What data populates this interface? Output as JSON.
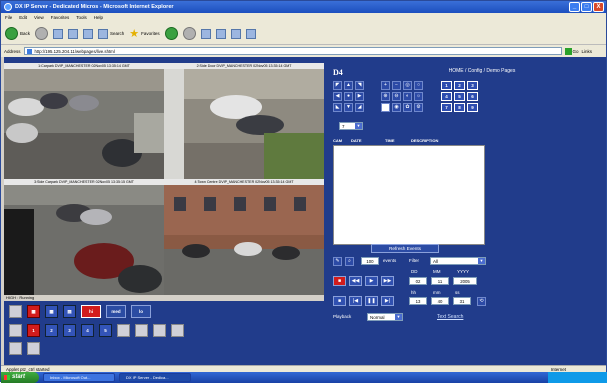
{
  "window": {
    "title": "DX IP Server - Dedicated Micros - Microsoft Internet Explorer",
    "controls": [
      "_",
      "□",
      "X"
    ]
  },
  "menu": [
    "File",
    "Edit",
    "View",
    "Favorites",
    "Tools",
    "Help"
  ],
  "toolbar": {
    "back": "Back",
    "search": "Search",
    "favorites": "Favorites"
  },
  "address": {
    "label": "Address",
    "url": "http://195.125.204.11/webpages/live.shtml",
    "go": "Go",
    "links": "Links"
  },
  "cameras": [
    {
      "caption": "1:Carpark DVIP_MANCHESTER 02Nov05 13:35:14 GMT"
    },
    {
      "caption": "2:Side Door DVIP_MANCHESTER 02Nov05 13:35:14 GMT"
    },
    {
      "caption": "3:Side Carpark DVIP_MANCHESTER 02Nov05 13:35:15 GMT"
    },
    {
      "caption": "4:Town Centre DVIP_MANCHESTER 02Nov05 13:35:14 GMT"
    }
  ],
  "stream_status": "HIGH : Running",
  "layout_buttons": {
    "hi": "hi",
    "med": "med",
    "lo": "lo"
  },
  "camera_numbers": [
    "1",
    "2",
    "3",
    "4",
    "5"
  ],
  "panel": {
    "logo": "D4",
    "nav": "HOME / Config / Demo Pages",
    "keypad": [
      "1",
      "2",
      "3",
      "4",
      "5",
      "6",
      "7",
      "8",
      "9"
    ],
    "preset_value": "7",
    "event_columns": [
      "CAM",
      "DATE",
      "TIME",
      "DESCRIPTION"
    ],
    "refresh_label": "Refresh Events",
    "events_count": "100",
    "events_label": "events",
    "filter_label": "Filter",
    "filter_value": "All",
    "date_labels": [
      "DD",
      "MM",
      "YYYY"
    ],
    "date_values": [
      "02",
      "11",
      "2005"
    ],
    "time_labels": [
      "hh",
      "mm",
      "ss"
    ],
    "time_values": [
      "13",
      "40",
      "31"
    ],
    "playback_label": "Playback",
    "playback_value": "Normal",
    "text_search": "Text Search"
  },
  "status": {
    "left": "Applet ptz_ctrl started",
    "zone": "Internet"
  },
  "taskbar": {
    "start": "start",
    "tasks": [
      "Inbox - Microsoft Out...",
      "DX IP Server - Dedica..."
    ]
  }
}
